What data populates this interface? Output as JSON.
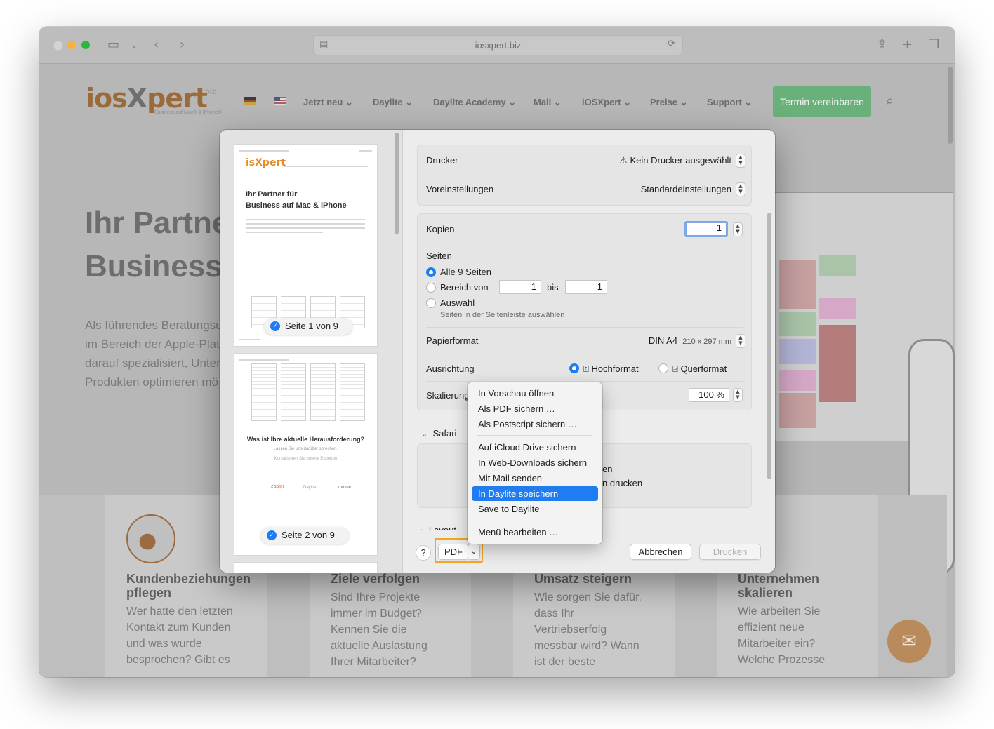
{
  "browser": {
    "url": "iosxpert.biz"
  },
  "website": {
    "logo": {
      "prefix": "ios",
      "x": "X",
      "suffix": "pert",
      "biz": "biz",
      "tagline": "Business auf Mac® & iPhone®"
    },
    "nav": [
      "Jetzt neu",
      "Daylite",
      "Daylite Academy",
      "Mail",
      "iOSXpert",
      "Preise",
      "Support"
    ],
    "cta": "Termin vereinbaren",
    "hero_title": "Ihr Partne\nBusiness a",
    "hero_text": "Als führendes Beratungsu\nim Bereich der Apple-Plat\ndarauf spezialisiert, Unter\nProdukten optimieren mö",
    "cards": [
      {
        "title": "Kundenbeziehungen pflegen",
        "text": "Wer hatte den letzten\nKontakt zum Kunden\nund was wurde\nbesprochen? Gibt es"
      },
      {
        "title": "Ziele verfolgen",
        "text": "Sind Ihre Projekte\nimmer im Budget?\nKennen Sie die\naktuelle Auslastung\nIhrer Mitarbeiter?"
      },
      {
        "title": "Umsatz steigern",
        "text": "Wie sorgen Sie dafür,\ndass Ihr\nVertriebserfolg\nmessbar wird? Wann\nist der beste"
      },
      {
        "title": "Unternehmen skalieren",
        "text": "Wie arbeiten Sie\neffizient neue\nMitarbeiter ein?\nWelche Prozesse"
      }
    ]
  },
  "print_dialog": {
    "thumbnails": [
      {
        "title": "Ihr Partner für\nBusiness auf Mac & iPhone",
        "page_label": "Seite 1 von 9"
      },
      {
        "title": "Was ist Ihre aktuelle Herausforderung?",
        "subtitle": "Lassen Sie uns darüber sprechen.",
        "link": "Kontaktieren Sie unsere Experten",
        "logos": [
          "zapier",
          "Daylite",
          "moxee"
        ],
        "page_label": "Seite 2 von 9"
      }
    ],
    "printer_label": "Drucker",
    "printer_value": "Kein Drucker ausgewählt",
    "presets_label": "Voreinstellungen",
    "presets_value": "Standardeinstellungen",
    "copies_label": "Kopien",
    "copies_value": "1",
    "pages_label": "Seiten",
    "pages_all": "Alle 9 Seiten",
    "pages_range": "Bereich von",
    "range_from": "1",
    "range_to_label": "bis",
    "range_to": "1",
    "pages_selection": "Auswahl",
    "pages_selection_hint": "Seiten in der Seitenleiste auswählen",
    "paper_label": "Papierformat",
    "paper_value": "DIN A4",
    "paper_size": "210 x 297 mm",
    "orientation_label": "Ausrichtung",
    "orientation_portrait": "Hochformat",
    "orientation_landscape": "Querformat",
    "scaling_label": "Skalierung",
    "scaling_value": "100 %",
    "safari_section": "Safari",
    "safari_option1_partial": "cken",
    "safari_option2_partial": "ilen drucken",
    "layout_section": "Layout",
    "help": "?",
    "pdf_button": "PDF",
    "cancel_button": "Abbrechen",
    "print_button": "Drucken"
  },
  "pdf_menu": {
    "items": [
      "In Vorschau öffnen",
      "Als PDF sichern …",
      "Als Postscript sichern …",
      "Auf iCloud Drive sichern",
      "In Web-Downloads sichern",
      "Mit Mail senden",
      "In Daylite speichern",
      "Save to Daylite",
      "Menü bearbeiten …"
    ],
    "selected": "In Daylite speichern"
  },
  "colors": {
    "accent": "#1f7cf1",
    "highlight_border": "#f5a623",
    "cta_green": "#69b07a"
  }
}
